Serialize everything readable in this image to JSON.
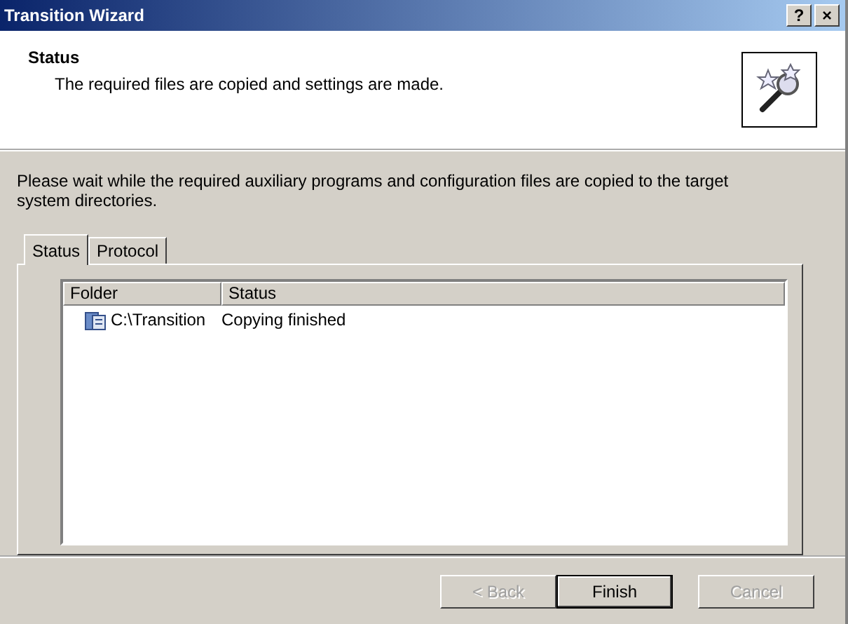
{
  "window": {
    "title": "Transition Wizard",
    "controls": [
      "?",
      "×"
    ]
  },
  "header": {
    "title": "Status",
    "subtitle": "The required files are copied and settings are made."
  },
  "description": "Please wait while the required auxiliary programs and configuration files are copied to the target system directories.",
  "tabs": [
    {
      "label": "Status",
      "selected": true
    },
    {
      "label": "Protocol",
      "selected": false
    }
  ],
  "table": {
    "columns": [
      "Folder",
      "Status"
    ],
    "rows": [
      {
        "folder": "C:\\Transition",
        "status": "Copying finished"
      }
    ]
  },
  "buttons": [
    {
      "label": "< Back",
      "disabled": true,
      "default": false
    },
    {
      "label": "Finish",
      "disabled": false,
      "default": true
    },
    {
      "label": "Cancel",
      "disabled": true,
      "default": false
    }
  ]
}
